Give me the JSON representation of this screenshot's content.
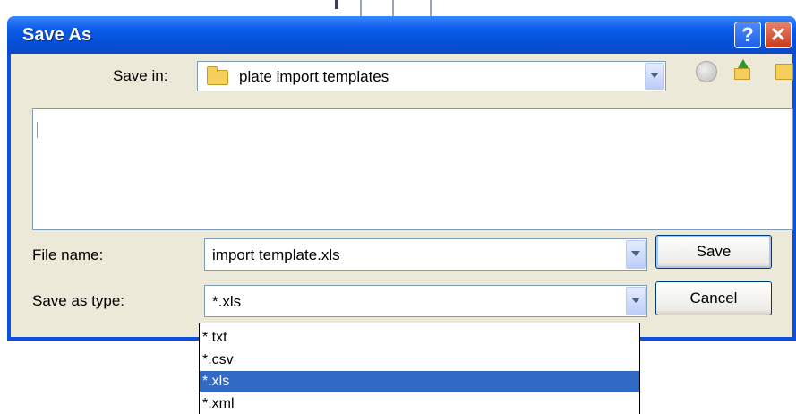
{
  "window": {
    "title": "Save As",
    "help_glyph": "?",
    "close_glyph": "✕",
    "title_bar_color": "#0a52de",
    "client_color": "#ece9d8"
  },
  "save_in": {
    "label": "Save in:",
    "value": "plate import templates",
    "icon": "folder-icon"
  },
  "toolbar": {
    "back_icon": "back-icon",
    "up_icon": "up-one-level-icon",
    "new_folder_icon": "new-folder-icon"
  },
  "file_name": {
    "label": "File name:",
    "value": "import template.xls"
  },
  "save_as_type": {
    "label": "Save as type:",
    "value": "*.xls",
    "options": [
      "*.txt",
      "*.csv",
      "*.xls",
      "*.xml"
    ],
    "highlighted": "*.xls",
    "highlight_color": "#316ac5"
  },
  "buttons": {
    "save": "Save",
    "cancel": "Cancel"
  }
}
